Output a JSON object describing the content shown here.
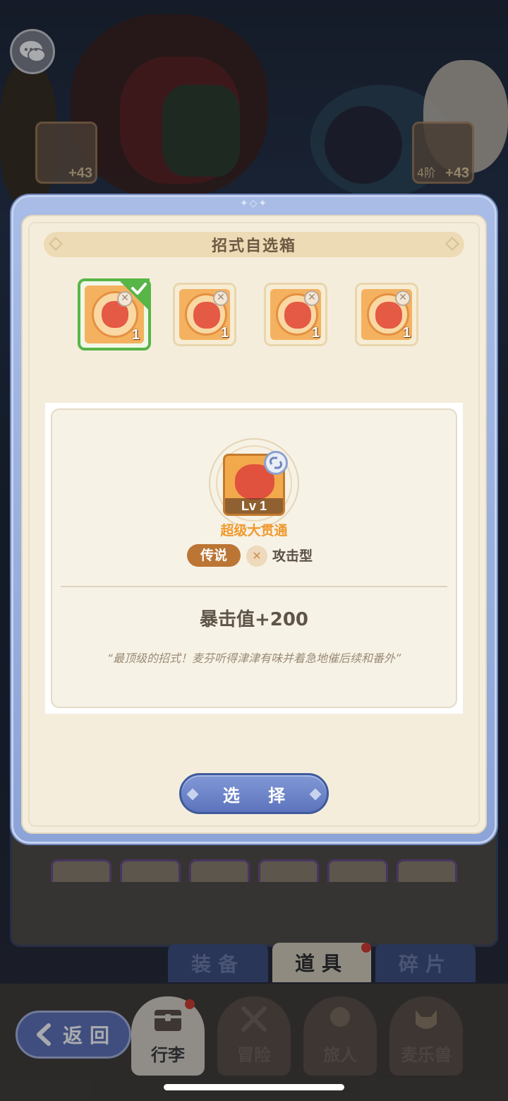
{
  "modal": {
    "title": "招式自选箱",
    "options": [
      {
        "count": "1",
        "selected": true
      },
      {
        "count": "1",
        "selected": false
      },
      {
        "count": "1",
        "selected": false
      },
      {
        "count": "1",
        "selected": false
      }
    ],
    "detail": {
      "level_label": "Lv 1",
      "skill_name": "超级大贯通",
      "rarity": "传说",
      "type": "攻击型",
      "stat": "暴击值+200",
      "flavor": "“最顶级的招式！麦芬听得津津有味并着急地催后续和番外”"
    },
    "select_button": "选 择"
  },
  "equipment": {
    "left_slot": {
      "level": "+43"
    },
    "right_slot": {
      "tier": "4阶",
      "level": "+43"
    }
  },
  "sub_tabs": [
    {
      "label": "装备",
      "active": false
    },
    {
      "label": "道具",
      "active": true
    },
    {
      "label": "碎片",
      "active": false
    }
  ],
  "bottom_nav": {
    "back_label": "返回",
    "items": [
      {
        "label": "行李",
        "active": true
      },
      {
        "label": "冒险",
        "active": false
      },
      {
        "label": "旅人",
        "active": false
      },
      {
        "label": "麦乐兽",
        "active": false
      }
    ]
  },
  "colors": {
    "modal_frame": "#8ca4d8",
    "panel_bg": "#f5eddc",
    "selected_border": "#58b548",
    "rarity_bg": "#bb7534",
    "skill_name": "#ef9a2e",
    "button": "#5d74bd"
  }
}
